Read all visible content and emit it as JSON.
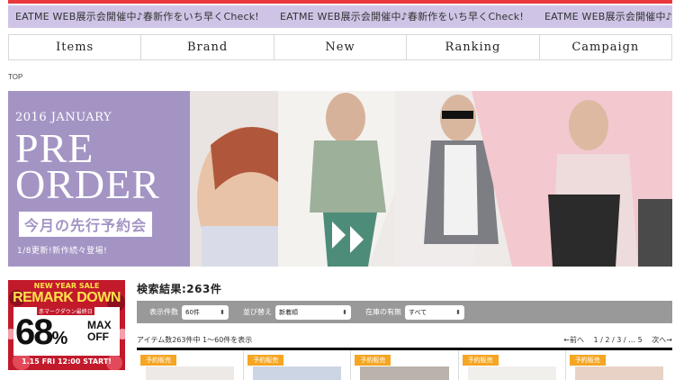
{
  "announcement": {
    "items": [
      "EATME WEB展示会開催中♪春新作をいち早くCheck!",
      "EATME WEB展示会開催中♪春新作をいち早くCheck!",
      "EATME WEB展示会開催中♪春新作をいち早くCheck!"
    ],
    "bg_color": "#cfc4e6"
  },
  "nav": {
    "items": [
      "Items",
      "Brand",
      "New",
      "Ranking",
      "Campaign"
    ]
  },
  "breadcrumb": "TOP",
  "hero": {
    "subtitle": "2016 JANUARY",
    "title_line1": "PRE",
    "title_line2": "ORDER",
    "jp_title": "今月の先行予約会",
    "update_text": "1/8更新!新作続々登場!",
    "panel_color": "#a494c4"
  },
  "side_banner": {
    "top_text": "NEW YEAR SALE",
    "headline": "REMARK DOWN",
    "small_text": "赤マークダウン最終日",
    "percent": "68",
    "percent_unit": "%",
    "max_text": "MAX",
    "off_text": "OFF",
    "start_text": "1.15 FRI 12:00 START!"
  },
  "search": {
    "result_title": "検索結果:263件",
    "filters": [
      {
        "label": "表示件数",
        "value": "60件"
      },
      {
        "label": "並び替え",
        "value": "新着順"
      },
      {
        "label": "在庫の有無",
        "value": "すべて"
      }
    ],
    "count_text": "アイテム数263件中 1〜60件を表示",
    "pager": {
      "prev": "←前へ",
      "pages": "1 / 2 / 3 / … 5",
      "next": "次へ→"
    }
  },
  "products": [
    {
      "badge": "予約販売"
    },
    {
      "badge": "予約販売"
    },
    {
      "badge": "予約販売"
    },
    {
      "badge": "予約販売"
    },
    {
      "badge": "予約販売"
    }
  ]
}
